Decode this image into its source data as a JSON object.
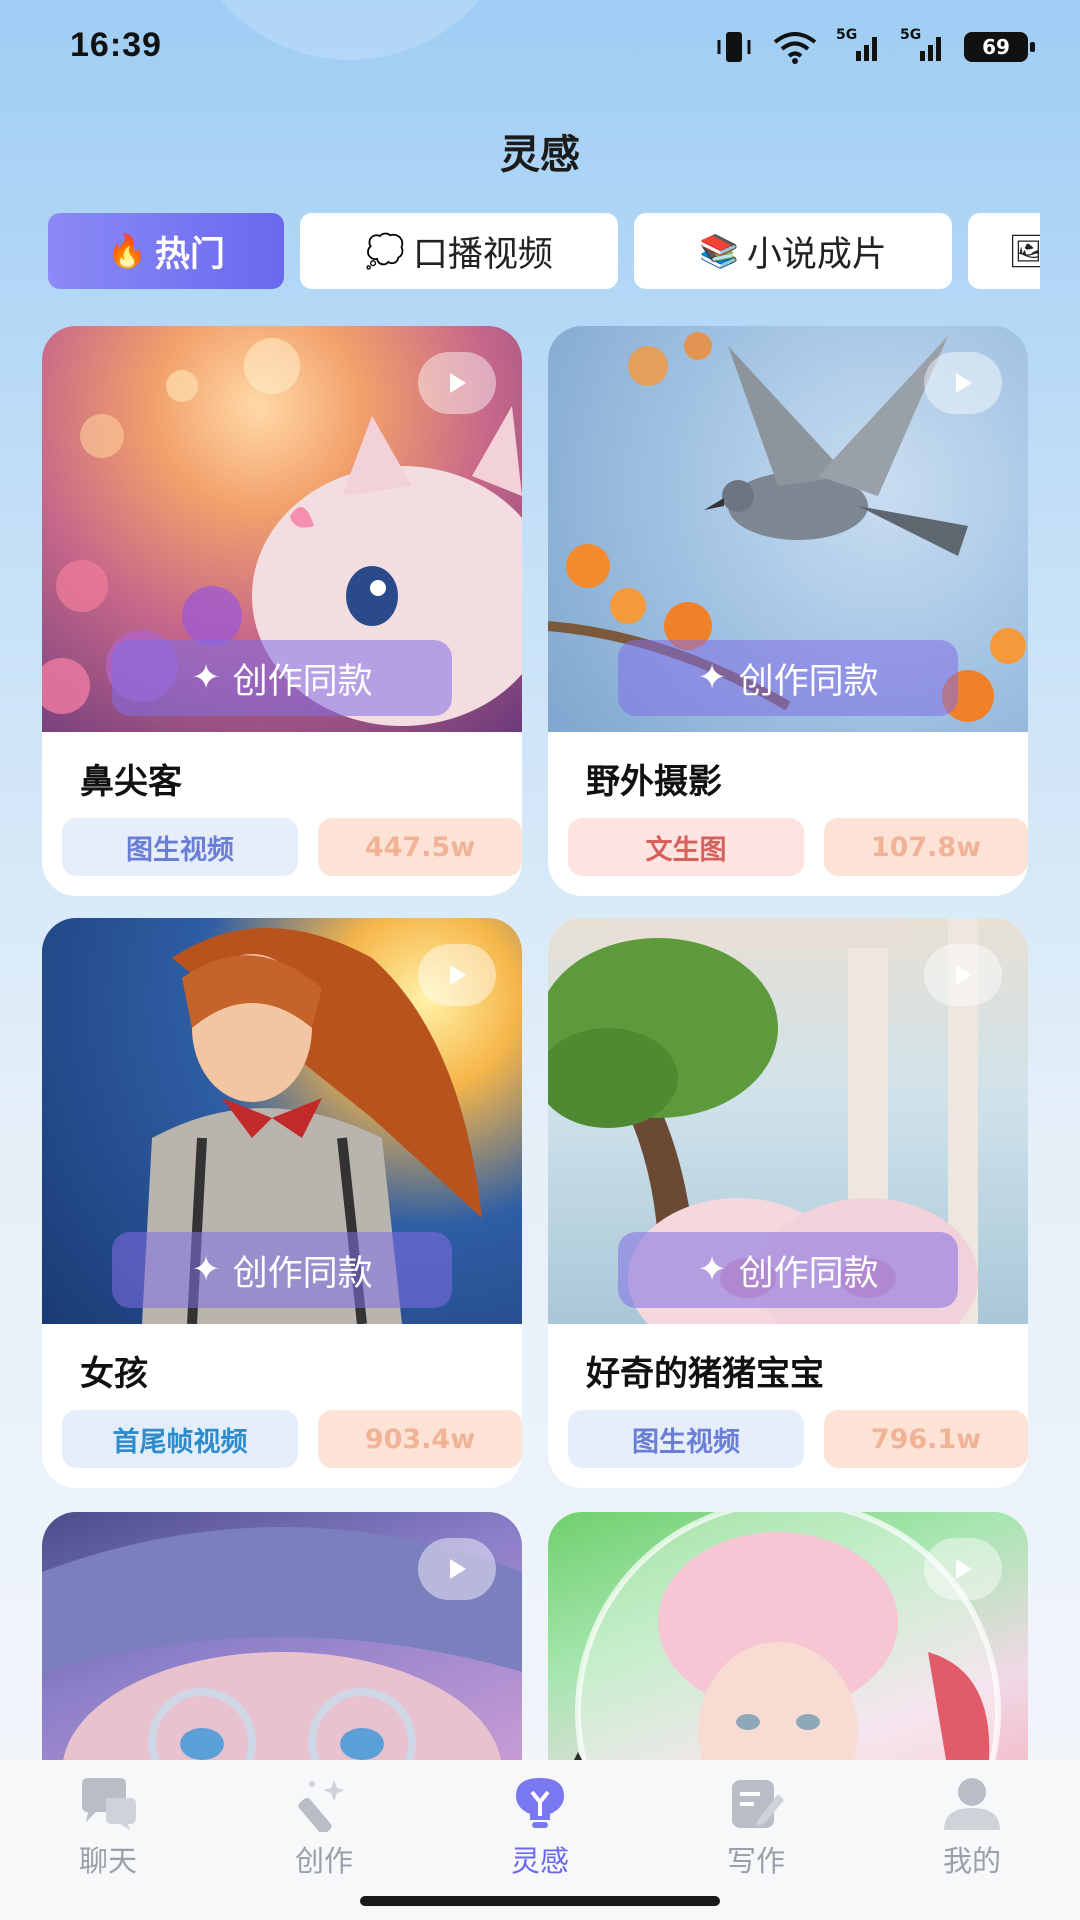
{
  "status_bar": {
    "time": "16:39",
    "signal1": "5G",
    "signal2": "5G",
    "battery": "69"
  },
  "header": {
    "title": "灵感"
  },
  "tabs": [
    {
      "emoji": "🔥",
      "label": "热门"
    },
    {
      "emoji": "💭",
      "label": "口播视频"
    },
    {
      "emoji": "📚",
      "label": "小说成片"
    },
    {
      "emoji": "🖼",
      "label": ""
    }
  ],
  "create_label": "创作同款",
  "cards": [
    {
      "title": "鼻尖客",
      "type": "图生视频",
      "count": "447.5w"
    },
    {
      "title": "野外摄影",
      "type": "文生图",
      "count": "107.8w"
    },
    {
      "title": "女孩",
      "type": "首尾帧视频",
      "count": "903.4w"
    },
    {
      "title": "好奇的猪猪宝宝",
      "type": "图生视频",
      "count": "796.1w"
    }
  ],
  "nav": [
    {
      "label": "聊天",
      "icon": "chat-icon"
    },
    {
      "label": "创作",
      "icon": "magic-wand-icon"
    },
    {
      "label": "灵感",
      "icon": "lightbulb-icon"
    },
    {
      "label": "写作",
      "icon": "edit-icon"
    },
    {
      "label": "我的",
      "icon": "user-icon"
    }
  ],
  "colors": {
    "accent": "#6a68ee",
    "count_chip": "#fde3d6"
  }
}
